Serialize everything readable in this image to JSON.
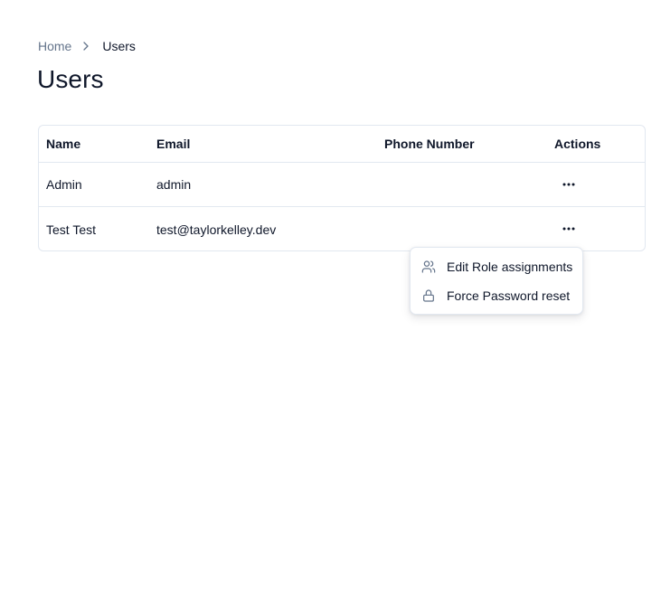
{
  "breadcrumb": {
    "home": "Home",
    "current": "Users"
  },
  "page_title": "Users",
  "table": {
    "columns": [
      "Name",
      "Email",
      "Phone Number",
      "Actions"
    ],
    "rows": [
      {
        "name": "Admin",
        "email": "admin",
        "phone": ""
      },
      {
        "name": "Test Test",
        "email": "test@taylorkelley.dev",
        "phone": ""
      }
    ]
  },
  "menu": {
    "items": [
      {
        "label": "Edit Role assignments",
        "icon": "users-icon"
      },
      {
        "label": "Force Password reset",
        "icon": "lock-icon"
      }
    ]
  },
  "colors": {
    "text": "#0f172a",
    "muted": "#64748b",
    "border": "#e2e8f0",
    "icon": "#64748b"
  }
}
